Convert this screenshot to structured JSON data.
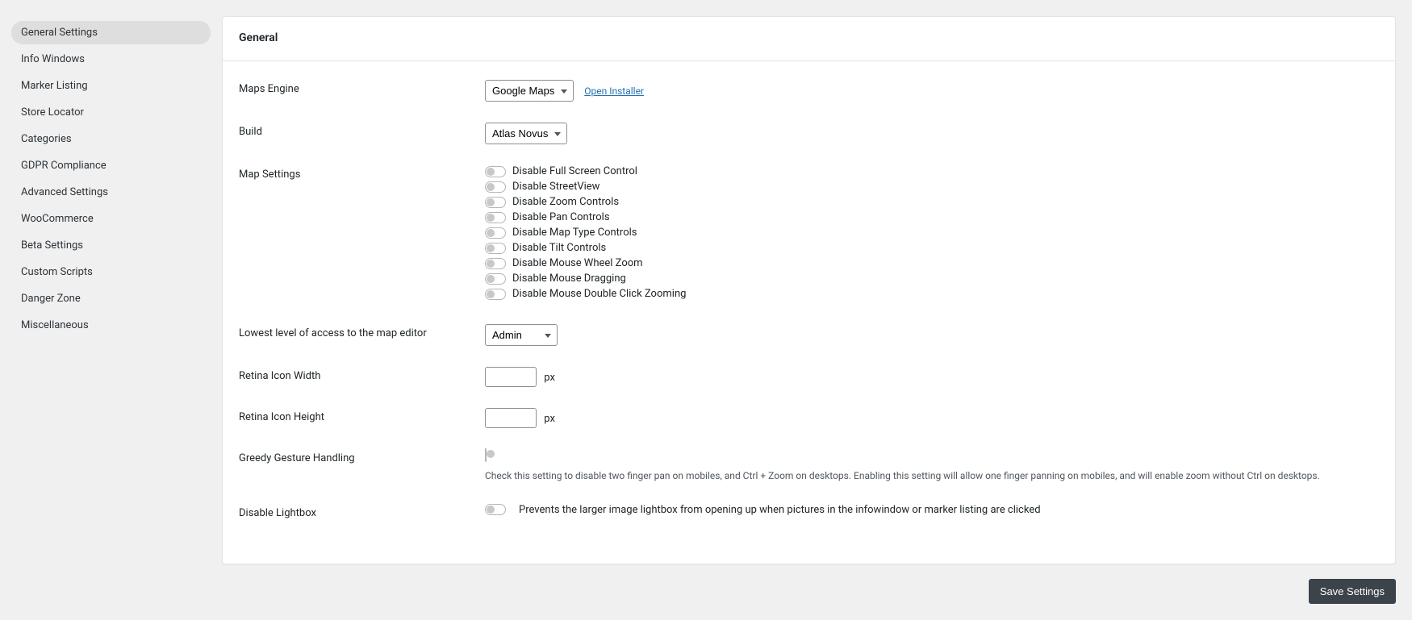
{
  "sidebar": {
    "items": [
      {
        "label": "General Settings",
        "active": true
      },
      {
        "label": "Info Windows",
        "active": false
      },
      {
        "label": "Marker Listing",
        "active": false
      },
      {
        "label": "Store Locator",
        "active": false
      },
      {
        "label": "Categories",
        "active": false
      },
      {
        "label": "GDPR Compliance",
        "active": false
      },
      {
        "label": "Advanced Settings",
        "active": false
      },
      {
        "label": "WooCommerce",
        "active": false
      },
      {
        "label": "Beta Settings",
        "active": false
      },
      {
        "label": "Custom Scripts",
        "active": false
      },
      {
        "label": "Danger Zone",
        "active": false
      },
      {
        "label": "Miscellaneous",
        "active": false
      }
    ]
  },
  "header": {
    "title": "General"
  },
  "fields": {
    "maps_engine": {
      "label": "Maps Engine",
      "value": "Google Maps",
      "link": "Open Installer"
    },
    "build": {
      "label": "Build",
      "value": "Atlas Novus"
    },
    "map_settings": {
      "label": "Map Settings",
      "toggles": [
        "Disable Full Screen Control",
        "Disable StreetView",
        "Disable Zoom Controls",
        "Disable Pan Controls",
        "Disable Map Type Controls",
        "Disable Tilt Controls",
        "Disable Mouse Wheel Zoom",
        "Disable Mouse Dragging",
        "Disable Mouse Double Click Zooming"
      ]
    },
    "access_level": {
      "label": "Lowest level of access to the map editor",
      "value": "Admin"
    },
    "retina_width": {
      "label": "Retina Icon Width",
      "value": "",
      "suffix": "px"
    },
    "retina_height": {
      "label": "Retina Icon Height",
      "value": "",
      "suffix": "px"
    },
    "greedy_gesture": {
      "label": "Greedy Gesture Handling",
      "helper": "Check this setting to disable two finger pan on mobiles, and Ctrl + Zoom on desktops. Enabling this setting will allow one finger panning on mobiles, and will enable zoom without Ctrl on desktops."
    },
    "disable_lightbox": {
      "label": "Disable Lightbox",
      "desc": "Prevents the larger image lightbox from opening up when pictures in the infowindow or marker listing are clicked"
    }
  },
  "footer": {
    "save": "Save Settings"
  }
}
